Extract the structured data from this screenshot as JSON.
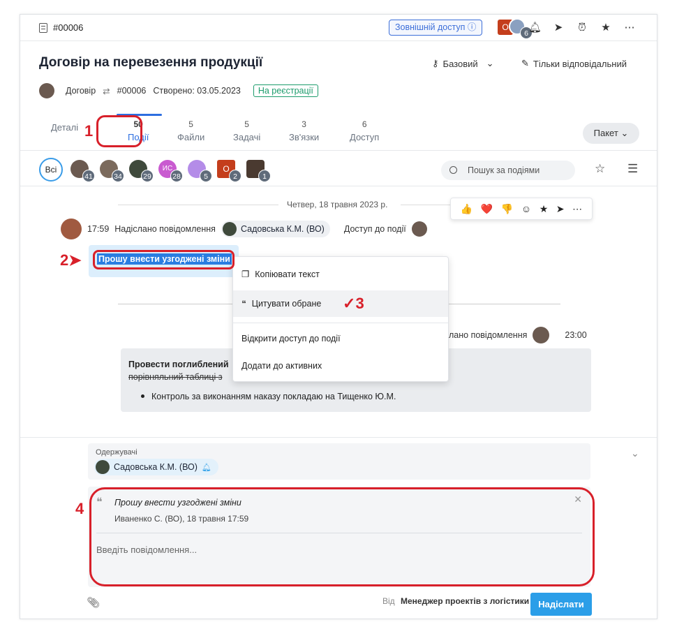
{
  "topbar": {
    "doc_id": "#00006",
    "external_access": "Зовнішній доступ ⓘ",
    "o_badge": "O",
    "group_count": "6"
  },
  "header": {
    "title": "Договір на перевезення продукції",
    "access_level": "Базовий",
    "responsible": "Тільки відповідальний"
  },
  "meta": {
    "type": "Договір",
    "number": "#00006",
    "created": "Створено: 03.05.2023",
    "status": "На реєстрації"
  },
  "tabs": [
    {
      "count": "",
      "label": "Деталі"
    },
    {
      "count": "50",
      "label": "Події"
    },
    {
      "count": "5",
      "label": "Файли"
    },
    {
      "count": "5",
      "label": "Задачі"
    },
    {
      "count": "3",
      "label": "Зв'язки"
    },
    {
      "count": "6",
      "label": "Доступ"
    }
  ],
  "packet_label": "Пакет",
  "filters": {
    "all_label": "Всі",
    "avatars": [
      {
        "count": "41",
        "color": "#6b5a50"
      },
      {
        "count": "34",
        "color": "#7b6a5c"
      },
      {
        "count": "29",
        "color": "#3f4a3c"
      },
      {
        "count": "28",
        "color": "#c95bd0",
        "initials": "ИС"
      },
      {
        "count": "5",
        "color": "#b48ce8"
      },
      {
        "count": "2",
        "color": "#c43e1c",
        "initials": "O"
      },
      {
        "count": "1",
        "color": "#4a3a30"
      }
    ],
    "search_placeholder": "Пошук за подіями"
  },
  "events": {
    "date": "Четвер, 18 травня 2023 р.",
    "reactions": [
      "👍",
      "❤️",
      "👎",
      "☺",
      "★",
      "➤",
      "⋯"
    ],
    "time": "17:59",
    "action": "Надіслано повідомлення",
    "recipient": "Садовська К.М. (ВО)",
    "access_label": "Доступ до події",
    "message1": "Прошу внести узгоджені зміни",
    "event2_action": "лано повідомлення",
    "event2_time": "23:00",
    "message2_line1": "Провести поглиблений",
    "message2_line2_strike": "порівняльний ",
    "message2_line2_rest": "таблиці з",
    "message2_bullet": "Контроль за виконанням наказу покладаю на Тищенко Ю.М."
  },
  "context_menu": {
    "copy": "Копіювати текст",
    "quote": "Цитувати обране",
    "share": "Відкрити доступ до події",
    "add_active": "Додати до активних"
  },
  "composer": {
    "recipients_label": "Одержувачі",
    "recipient": "Садовська К.М. (ВО)",
    "quote_text": "Прошу внести узгоджені зміни",
    "quote_meta": "Иваненко С. (ВО), 18 травня 17:59",
    "placeholder": "Введіть повідомлення...",
    "from_label": "Від",
    "from_value": "Менеджер проектів з логістики",
    "send_label": "Надіслати"
  },
  "annotations": [
    "1",
    "2",
    "3",
    "4"
  ]
}
